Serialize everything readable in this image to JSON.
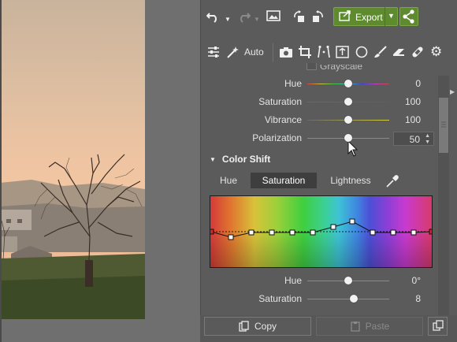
{
  "toolbar": {
    "undo_icon": "undo-icon",
    "redo_icon": "redo-icon",
    "image_icon": "image-icon",
    "rotate_left_icon": "rotate-left-icon",
    "rotate_right_icon": "rotate-right-icon",
    "export_label": "Export",
    "share_icon": "share-icon"
  },
  "tools": {
    "auto_label": "Auto",
    "icons": [
      "sliders-icon",
      "magic-wand-icon",
      "camera-icon",
      "crop-icon",
      "perspective-icon",
      "text-box-icon",
      "circle-icon",
      "brush-icon",
      "eraser-icon",
      "bandage-icon",
      "gear-icon"
    ]
  },
  "grayscale": {
    "label": "Grayscale",
    "checked": false
  },
  "sliders": [
    {
      "label": "Hue",
      "value": "0",
      "fraction": 0.5
    },
    {
      "label": "Saturation",
      "value": "100",
      "fraction": 0.5
    },
    {
      "label": "Vibrance",
      "value": "100",
      "fraction": 0.5
    },
    {
      "label": "Polarization",
      "value": "50",
      "fraction": 0.5
    }
  ],
  "color_shift": {
    "title": "Color Shift",
    "tabs": [
      "Hue",
      "Saturation",
      "Lightness"
    ],
    "active_tab": "Saturation",
    "eyedropper_icon": "eyedropper-icon"
  },
  "shift_sliders": [
    {
      "label": "Hue",
      "value": "0°",
      "fraction": 0.5
    },
    {
      "label": "Saturation",
      "value": "8",
      "fraction": 0.57
    }
  ],
  "bottom": {
    "copy_label": "Copy",
    "paste_label": "Paste",
    "copy_icon": "copy-icon",
    "paste_icon": "paste-icon",
    "duplicate_icon": "duplicate-icon"
  },
  "colors": {
    "accent_green": "#5e8b2e",
    "panel_bg": "#5b5b5b"
  }
}
